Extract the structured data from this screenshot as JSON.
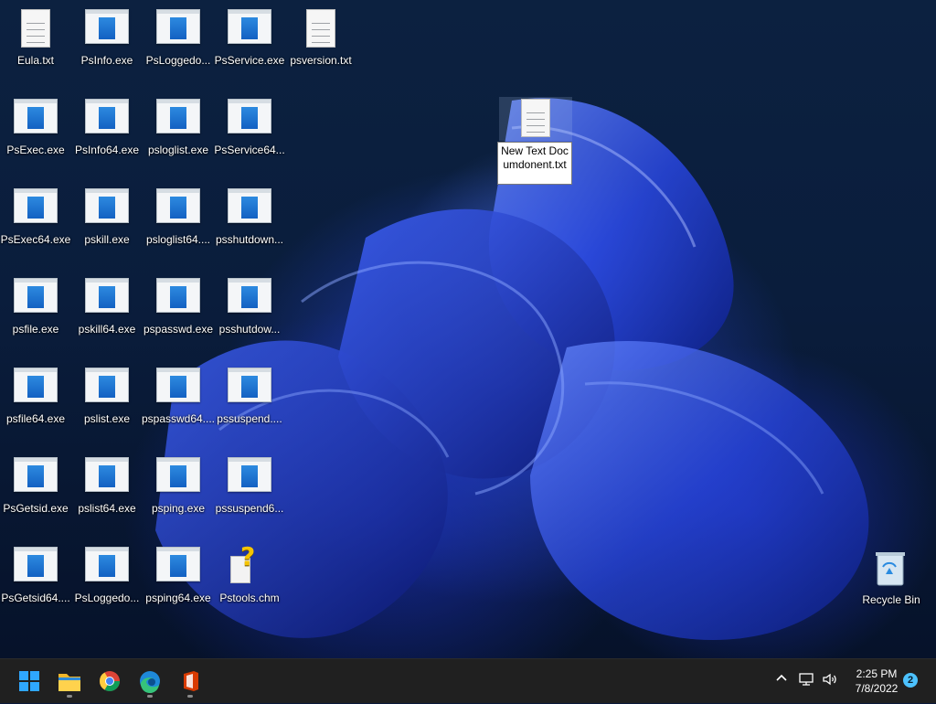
{
  "desktop": {
    "icons": [
      {
        "id": "eula",
        "label": "Eula.txt",
        "type": "txt"
      },
      {
        "id": "psinfo",
        "label": "PsInfo.exe",
        "type": "exe"
      },
      {
        "id": "psloggedon",
        "label": "PsLoggedo...",
        "type": "exe"
      },
      {
        "id": "psservice",
        "label": "PsService.exe",
        "type": "exe"
      },
      {
        "id": "psversion",
        "label": "psversion.txt",
        "type": "txt"
      },
      {
        "id": "psexec",
        "label": "PsExec.exe",
        "type": "exe"
      },
      {
        "id": "psinfo64",
        "label": "PsInfo64.exe",
        "type": "exe"
      },
      {
        "id": "psloglist",
        "label": "psloglist.exe",
        "type": "exe"
      },
      {
        "id": "psservice64",
        "label": "PsService64...",
        "type": "exe"
      },
      {
        "id": "psexec64",
        "label": "PsExec64.exe",
        "type": "exe"
      },
      {
        "id": "pskill",
        "label": "pskill.exe",
        "type": "exe"
      },
      {
        "id": "psloglist64",
        "label": "psloglist64....",
        "type": "exe"
      },
      {
        "id": "psshutdown",
        "label": "psshutdown...",
        "type": "exe"
      },
      {
        "id": "psfile",
        "label": "psfile.exe",
        "type": "exe"
      },
      {
        "id": "pskill64",
        "label": "pskill64.exe",
        "type": "exe"
      },
      {
        "id": "pspasswd",
        "label": "pspasswd.exe",
        "type": "exe"
      },
      {
        "id": "psshutdown64",
        "label": "psshutdow...",
        "type": "exe"
      },
      {
        "id": "psfile64",
        "label": "psfile64.exe",
        "type": "exe"
      },
      {
        "id": "pslist",
        "label": "pslist.exe",
        "type": "exe"
      },
      {
        "id": "pspasswd64",
        "label": "pspasswd64....",
        "type": "exe"
      },
      {
        "id": "pssuspend",
        "label": "pssuspend....",
        "type": "exe"
      },
      {
        "id": "psgetsid",
        "label": "PsGetsid.exe",
        "type": "exe"
      },
      {
        "id": "pslist64",
        "label": "pslist64.exe",
        "type": "exe"
      },
      {
        "id": "psping",
        "label": "psping.exe",
        "type": "exe"
      },
      {
        "id": "pssuspend64",
        "label": "pssuspend6...",
        "type": "exe"
      },
      {
        "id": "psgetsid64",
        "label": "PsGetsid64....",
        "type": "exe"
      },
      {
        "id": "psloggedon64",
        "label": "PsLoggedo...",
        "type": "exe"
      },
      {
        "id": "psping64",
        "label": "psping64.exe",
        "type": "exe"
      },
      {
        "id": "pstools-chm",
        "label": "Pstools.chm",
        "type": "chm"
      }
    ],
    "rename": {
      "value": "New Text Documdonent.txt"
    },
    "recycle_bin_label": "Recycle Bin"
  },
  "taskbar": {
    "apps": [
      {
        "id": "start",
        "icon": "windows-start-icon",
        "open": false
      },
      {
        "id": "explorer",
        "icon": "file-explorer-icon",
        "open": true
      },
      {
        "id": "chrome",
        "icon": "chrome-icon",
        "open": false
      },
      {
        "id": "edge",
        "icon": "edge-icon",
        "open": true
      },
      {
        "id": "office",
        "icon": "office-icon",
        "open": true
      }
    ],
    "clock_time": "2:25 PM",
    "clock_date": "7/8/2022",
    "notification_count": "2"
  },
  "colors": {
    "taskbar_bg": "#202020",
    "accent": "#4cc2ff",
    "exe_blue": "#1e74d6"
  }
}
